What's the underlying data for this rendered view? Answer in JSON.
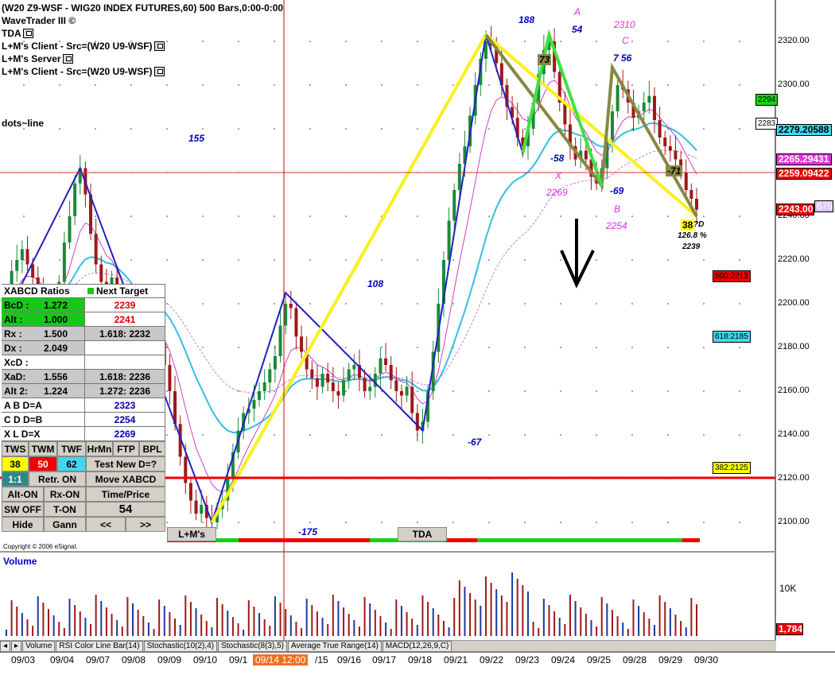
{
  "header": {
    "title": "(W20 Z9-WSF - WIG20 INDEX FUTURES,60) 500 Bars,0:00-0:00",
    "study1": "WaveTrader III ©",
    "study2": "TDA",
    "study3": "L+M's Client - Src=(W20 U9-WSF)",
    "study4": "L+M's Server",
    "study5": "L+M's Client - Src=(W20 U9-WSF)",
    "dots": "dots~line"
  },
  "price_axis": {
    "labels": [
      "2320.00",
      "2300.00",
      "2280.00",
      "2260.00",
      "2240.00",
      "2220.00",
      "2200.00",
      "2180.00",
      "2160.00",
      "2140.00",
      "2120.00",
      "2100.00"
    ]
  },
  "price_tags": {
    "t2294": "2294",
    "t2283": "2283",
    "cyan": "2279.20588",
    "magenta": "2265.29431",
    "cur": "2259.09422",
    "last": "2243.00",
    "purple": "675",
    "t500": "500:2213",
    "t618": "618:2185",
    "t382": "382:2125"
  },
  "wave_labels": {
    "w155": "155",
    "w175": "-175",
    "w108": "108",
    "w67": "-67",
    "w188": "188",
    "w58": "-58",
    "w54": "54",
    "w69": "-69",
    "w756": "7 56",
    "w73": "73",
    "w71": "-71",
    "w38": "38",
    "A": "A",
    "B": "B",
    "C": "C",
    "X": "X",
    "xval": "2269",
    "bval": "2254",
    "cval": "2310",
    "dq": "?D",
    "pct": "126.8 %",
    "dval": "2239"
  },
  "panel": {
    "title": "XABCD Ratios",
    "next": "Next Target",
    "bcd_k": "BcD :",
    "bcd_v": "1.272",
    "bcd_t": "2239",
    "alt_k": "Alt  :",
    "alt_v": "1.000",
    "alt_t": "2241",
    "rx_k": "Rx  :",
    "rx_v": "1.500",
    "rx_t": "1.618: 2232",
    "dx_k": "Dx  :",
    "dx_v": "2.049",
    "xcd_k": "XcD :",
    "xad_k": "XaD:",
    "xad_v": "1.556",
    "xad_t": "1.618: 2236",
    "alt2_k": "Alt 2:",
    "alt2_v": "1.224",
    "alt2_t": "1.272: 2236",
    "ab": "A  B  D=A",
    "ab_v": "2323",
    "cd": "C  D  D=B",
    "cd_v": "2254",
    "xx": "X  L  D=X",
    "xx_v": "2269",
    "tws": "TWS",
    "twm": "TWM",
    "twf": "TWF",
    "hrmn": "HrMn",
    "ftp": "FTP",
    "bpl": "BPL",
    "n38": "38",
    "n50": "50",
    "n62": "62",
    "testd": "Test New D=?",
    "one": "1:1",
    "retr": "Retr. ON",
    "move": "Move XABCD",
    "alton": "Alt-ON",
    "rxon": "Rx-ON",
    "tp": "Time/Price",
    "swoff": "SW OFF",
    "ton": "T-ON",
    "n54": "54",
    "hide": "Hide",
    "gann": "Gann",
    "prev": "<<",
    "next2": ">>",
    "lm": "L+M's",
    "tda": "TDA"
  },
  "copyright": "Copyright © 2006 eSignal.",
  "volume": {
    "label": "Volume",
    "tick": "10K",
    "last": "1,784"
  },
  "tabs": [
    "Volume",
    "RSI Color Line Bar(14)",
    "Stochastic(10(2),4)",
    "Stochastic(8(3),5)",
    "Average True Range(14)",
    "MACD(12,26,9,C)"
  ],
  "dates": [
    "09/03",
    "09/04",
    "09/07",
    "09/08",
    "09/09",
    "09/10",
    "09/1",
    "09/14 12:00",
    "/15",
    "09/16",
    "09/17",
    "09/18",
    "09/21",
    "09/22",
    "09/23",
    "09/24",
    "09/25",
    "09/28",
    "09/29",
    "09/30"
  ],
  "chart_data": {
    "type": "candlestick",
    "ylim": [
      2090,
      2330
    ],
    "closes": [
      2200,
      2215,
      2220,
      2225,
      2218,
      2212,
      2205,
      2198,
      2192,
      2196,
      2210,
      2228,
      2240,
      2255,
      2262,
      2250,
      2232,
      2218,
      2210,
      2205,
      2212,
      2200,
      2190,
      2185,
      2175,
      2170,
      2178,
      2186,
      2190,
      2182,
      2172,
      2160,
      2145,
      2130,
      2118,
      2110,
      2104,
      2108,
      2102,
      2100,
      2106,
      2110,
      2120,
      2132,
      2142,
      2150,
      2152,
      2156,
      2160,
      2164,
      2170,
      2176,
      2190,
      2200,
      2198,
      2185,
      2178,
      2170,
      2166,
      2162,
      2168,
      2164,
      2160,
      2158,
      2165,
      2170,
      2172,
      2166,
      2160,
      2162,
      2168,
      2175,
      2172,
      2165,
      2160,
      2158,
      2162,
      2150,
      2142,
      2146,
      2160,
      2178,
      2200,
      2220,
      2238,
      2252,
      2264,
      2272,
      2286,
      2300,
      2312,
      2320,
      2318,
      2310,
      2300,
      2290,
      2285,
      2276,
      2272,
      2280,
      2292,
      2305,
      2316,
      2320,
      2306,
      2292,
      2282,
      2272,
      2266,
      2270,
      2266,
      2258,
      2255,
      2262,
      2275,
      2288,
      2300,
      2298,
      2292,
      2285,
      2288,
      2292,
      2295,
      2284,
      2276,
      2272,
      2270,
      2266,
      2260,
      2252,
      2248,
      2243
    ],
    "ma_slow_last": 2279.2,
    "ma_fast_last": 2265.3,
    "current": 2259.09,
    "last": 2243.0,
    "horizontal_line": 2120,
    "volume_max": "10K"
  }
}
